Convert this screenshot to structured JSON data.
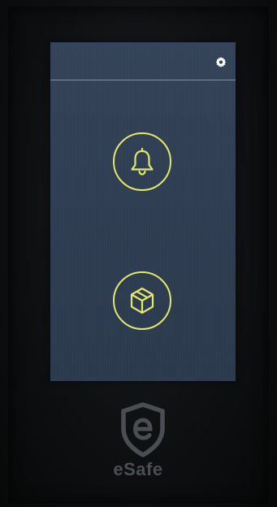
{
  "device": {
    "brand_name": "eSafe",
    "logo_letter": "e"
  },
  "screen": {
    "settings_icon": "gear-icon",
    "buttons": [
      {
        "name": "doorbell",
        "icon": "bell-icon"
      },
      {
        "name": "package",
        "icon": "package-icon"
      }
    ]
  },
  "colors": {
    "screen_background": "#334155",
    "accent_yellow": "#e4e86a",
    "logo_gray": "#4a4e53",
    "divider": "#becde1"
  }
}
